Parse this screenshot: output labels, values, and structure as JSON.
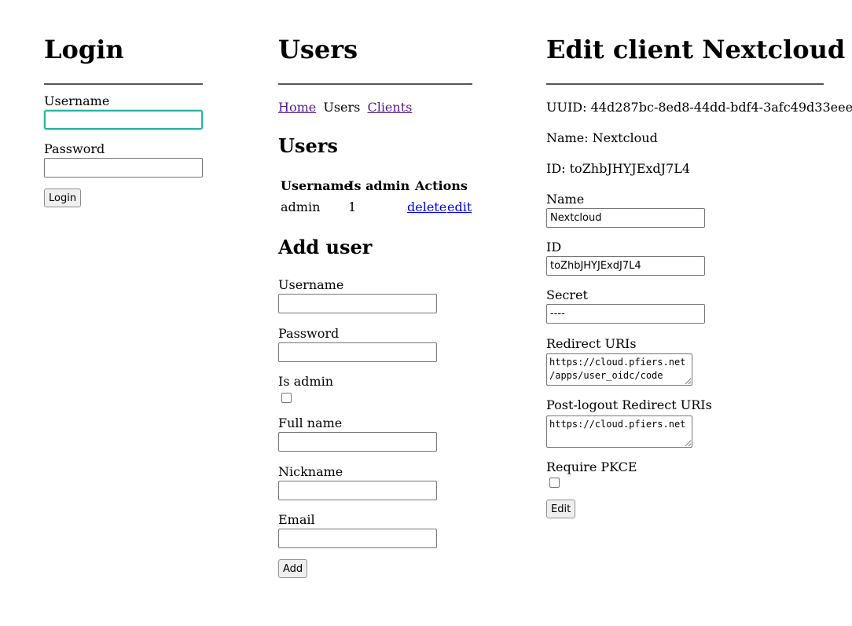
{
  "login": {
    "title": "Login",
    "username_label": "Username",
    "username_value": "",
    "password_label": "Password",
    "password_value": "",
    "submit_label": "Login"
  },
  "users": {
    "title": "Users",
    "nav": {
      "home": "Home",
      "users": "Users",
      "clients": "Clients"
    },
    "list_heading": "Users",
    "table": {
      "headers": [
        "Username",
        "Is admin",
        "Actions"
      ],
      "rows": [
        {
          "username": "admin",
          "is_admin": "1",
          "delete": "delete",
          "edit": "edit"
        }
      ]
    },
    "add_heading": "Add user",
    "form": {
      "username_label": "Username",
      "password_label": "Password",
      "is_admin_label": "Is admin",
      "full_name_label": "Full name",
      "nickname_label": "Nickname",
      "email_label": "Email",
      "submit_label": "Add"
    }
  },
  "client": {
    "title": "Edit client Nextcloud",
    "uuid_line": "UUID: 44d287bc-8ed8-44dd-bdf4-3afc49d33eee",
    "name_line": "Name: Nextcloud",
    "id_line": "ID: toZhbJHYJExdJ7L4",
    "form": {
      "name_label": "Name",
      "name_value": "Nextcloud",
      "id_label": "ID",
      "id_value": "toZhbJHYJExdJ7L4",
      "secret_label": "Secret",
      "secret_value": "----",
      "redirect_label": "Redirect URIs",
      "redirect_value": "https://cloud.pfiers.net/apps/user_oidc/code",
      "post_logout_label": "Post-logout Redirect URIs",
      "post_logout_value": "https://cloud.pfiers.net",
      "pkce_label": "Require PKCE",
      "submit_label": "Edit"
    }
  },
  "colors": {
    "visited_link": "#551a8b",
    "unvisited_link": "#0000ee",
    "focus_ring": "#2ab39f"
  }
}
